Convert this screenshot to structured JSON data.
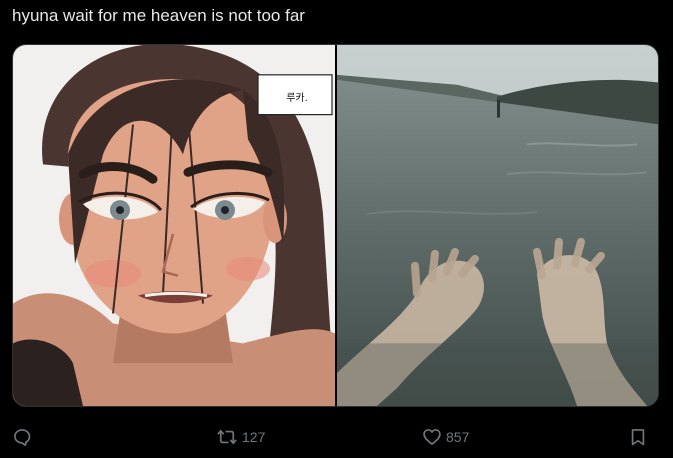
{
  "post": {
    "text": "hyuna wait for me heaven is not too far"
  },
  "media": {
    "left_panel": {
      "speech_bubble": "루카."
    }
  },
  "actions": {
    "reply": {
      "icon": "reply-icon",
      "count": ""
    },
    "repost": {
      "icon": "repost-icon",
      "count": "127"
    },
    "like": {
      "icon": "heart-icon",
      "count": "857"
    },
    "bookmark": {
      "icon": "bookmark-icon"
    }
  },
  "colors": {
    "background": "#000000",
    "text": "#e7e9ea",
    "muted": "#71767b",
    "border": "#2f3336"
  }
}
